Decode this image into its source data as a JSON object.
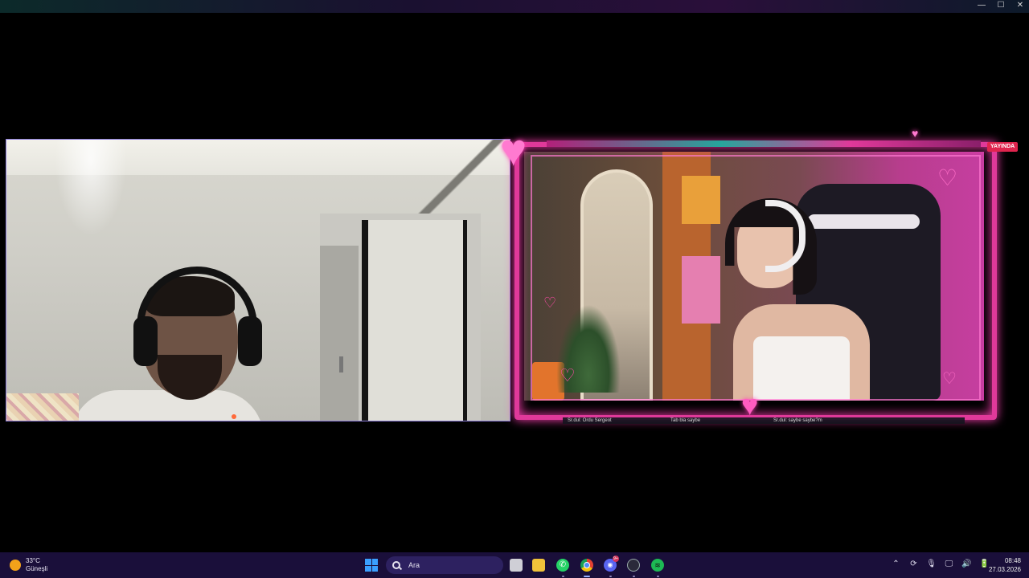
{
  "window": {
    "minimize_icon": "minimize-icon",
    "maximize_icon": "maximize-icon",
    "close_icon": "close-icon",
    "minimize_glyph": "—",
    "maximize_glyph": "☐",
    "close_glyph": "✕"
  },
  "stream": {
    "live_badge": "YAYINDA",
    "ticker": [
      "Sr.dul: Ordu Sergeot",
      "Tab bla saybe",
      "Sr.dul: saybe saybe?m"
    ]
  },
  "taskbar": {
    "weather": {
      "temp": "33°C",
      "condition": "Güneşli"
    },
    "search": {
      "placeholder": "Ara"
    },
    "discord_badge": "9+",
    "apps": [
      "task-view-icon",
      "file-explorer-icon",
      "whatsapp-icon",
      "chrome-icon",
      "discord-icon",
      "steam-icon",
      "spotify-icon"
    ],
    "tray_glyphs": [
      "⌃",
      "⟳",
      "🎙",
      "🖵",
      "🔊",
      "🔋"
    ],
    "time": "08:48",
    "date": "27.03.2026"
  },
  "colors": {
    "frame_pink": "#e0399a",
    "taskbar_bg": "#1a0f3a",
    "live_red": "#e0244e"
  }
}
